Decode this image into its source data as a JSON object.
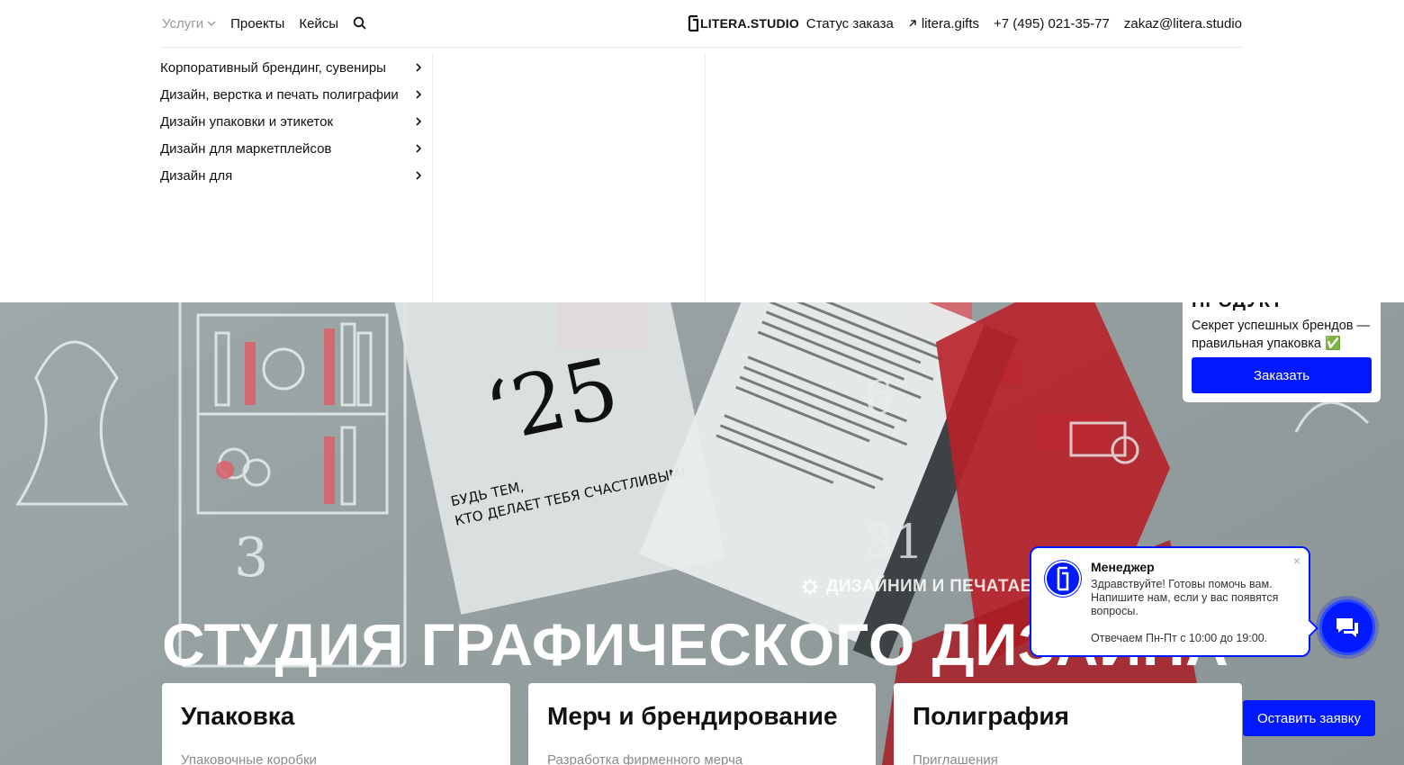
{
  "header": {
    "nav_left": [
      {
        "label": "Услуги",
        "active": true
      },
      {
        "label": "Проекты"
      },
      {
        "label": "Кейсы"
      }
    ],
    "logo_text": "LITERA.STUDIO",
    "nav_right": {
      "order_status": "Статус заказа",
      "gifts": "litera.gifts",
      "phone": "+7 (495) 021-35-77",
      "email": "zakaz@litera.studio"
    }
  },
  "services_menu": [
    "Корпоративный брендинг, сувениры",
    "Дизайн, верстка и печать полиграфии",
    "Дизайн упаковки и этикеток",
    "Дизайн для маркетплейсов",
    "Дизайн для"
  ],
  "promo": {
    "title": "ПРОДУКТ",
    "text": "Секрет успешных брендов — правильная упаковка ✅",
    "button": "Заказать"
  },
  "hero": {
    "kicker": "ДИЗАЙНИМ И ПЕЧАТАЕМ Н",
    "title": "СТУДИЯ ГРАФИЧЕСКОГО ДИЗАЙНА"
  },
  "cards": [
    {
      "title": "Упаковка",
      "sub": "Упаковочные коробки"
    },
    {
      "title": "Мерч и брендирование",
      "sub": "Разработка фирменного мерча"
    },
    {
      "title": "Полиграфия",
      "sub": "Приглашения"
    }
  ],
  "chat": {
    "name": "Менеджер",
    "message": "Здравствуйте! Готовы помочь вам. Напишите нам, если у вас появятся вопросы.",
    "hours": "Отвечаем Пн-Пт с 10:00 до 19:00.",
    "close": "×"
  },
  "request_button": "Оставить заявку",
  "colors": {
    "accent": "#0019ff",
    "hero_red": "#c0232b"
  }
}
